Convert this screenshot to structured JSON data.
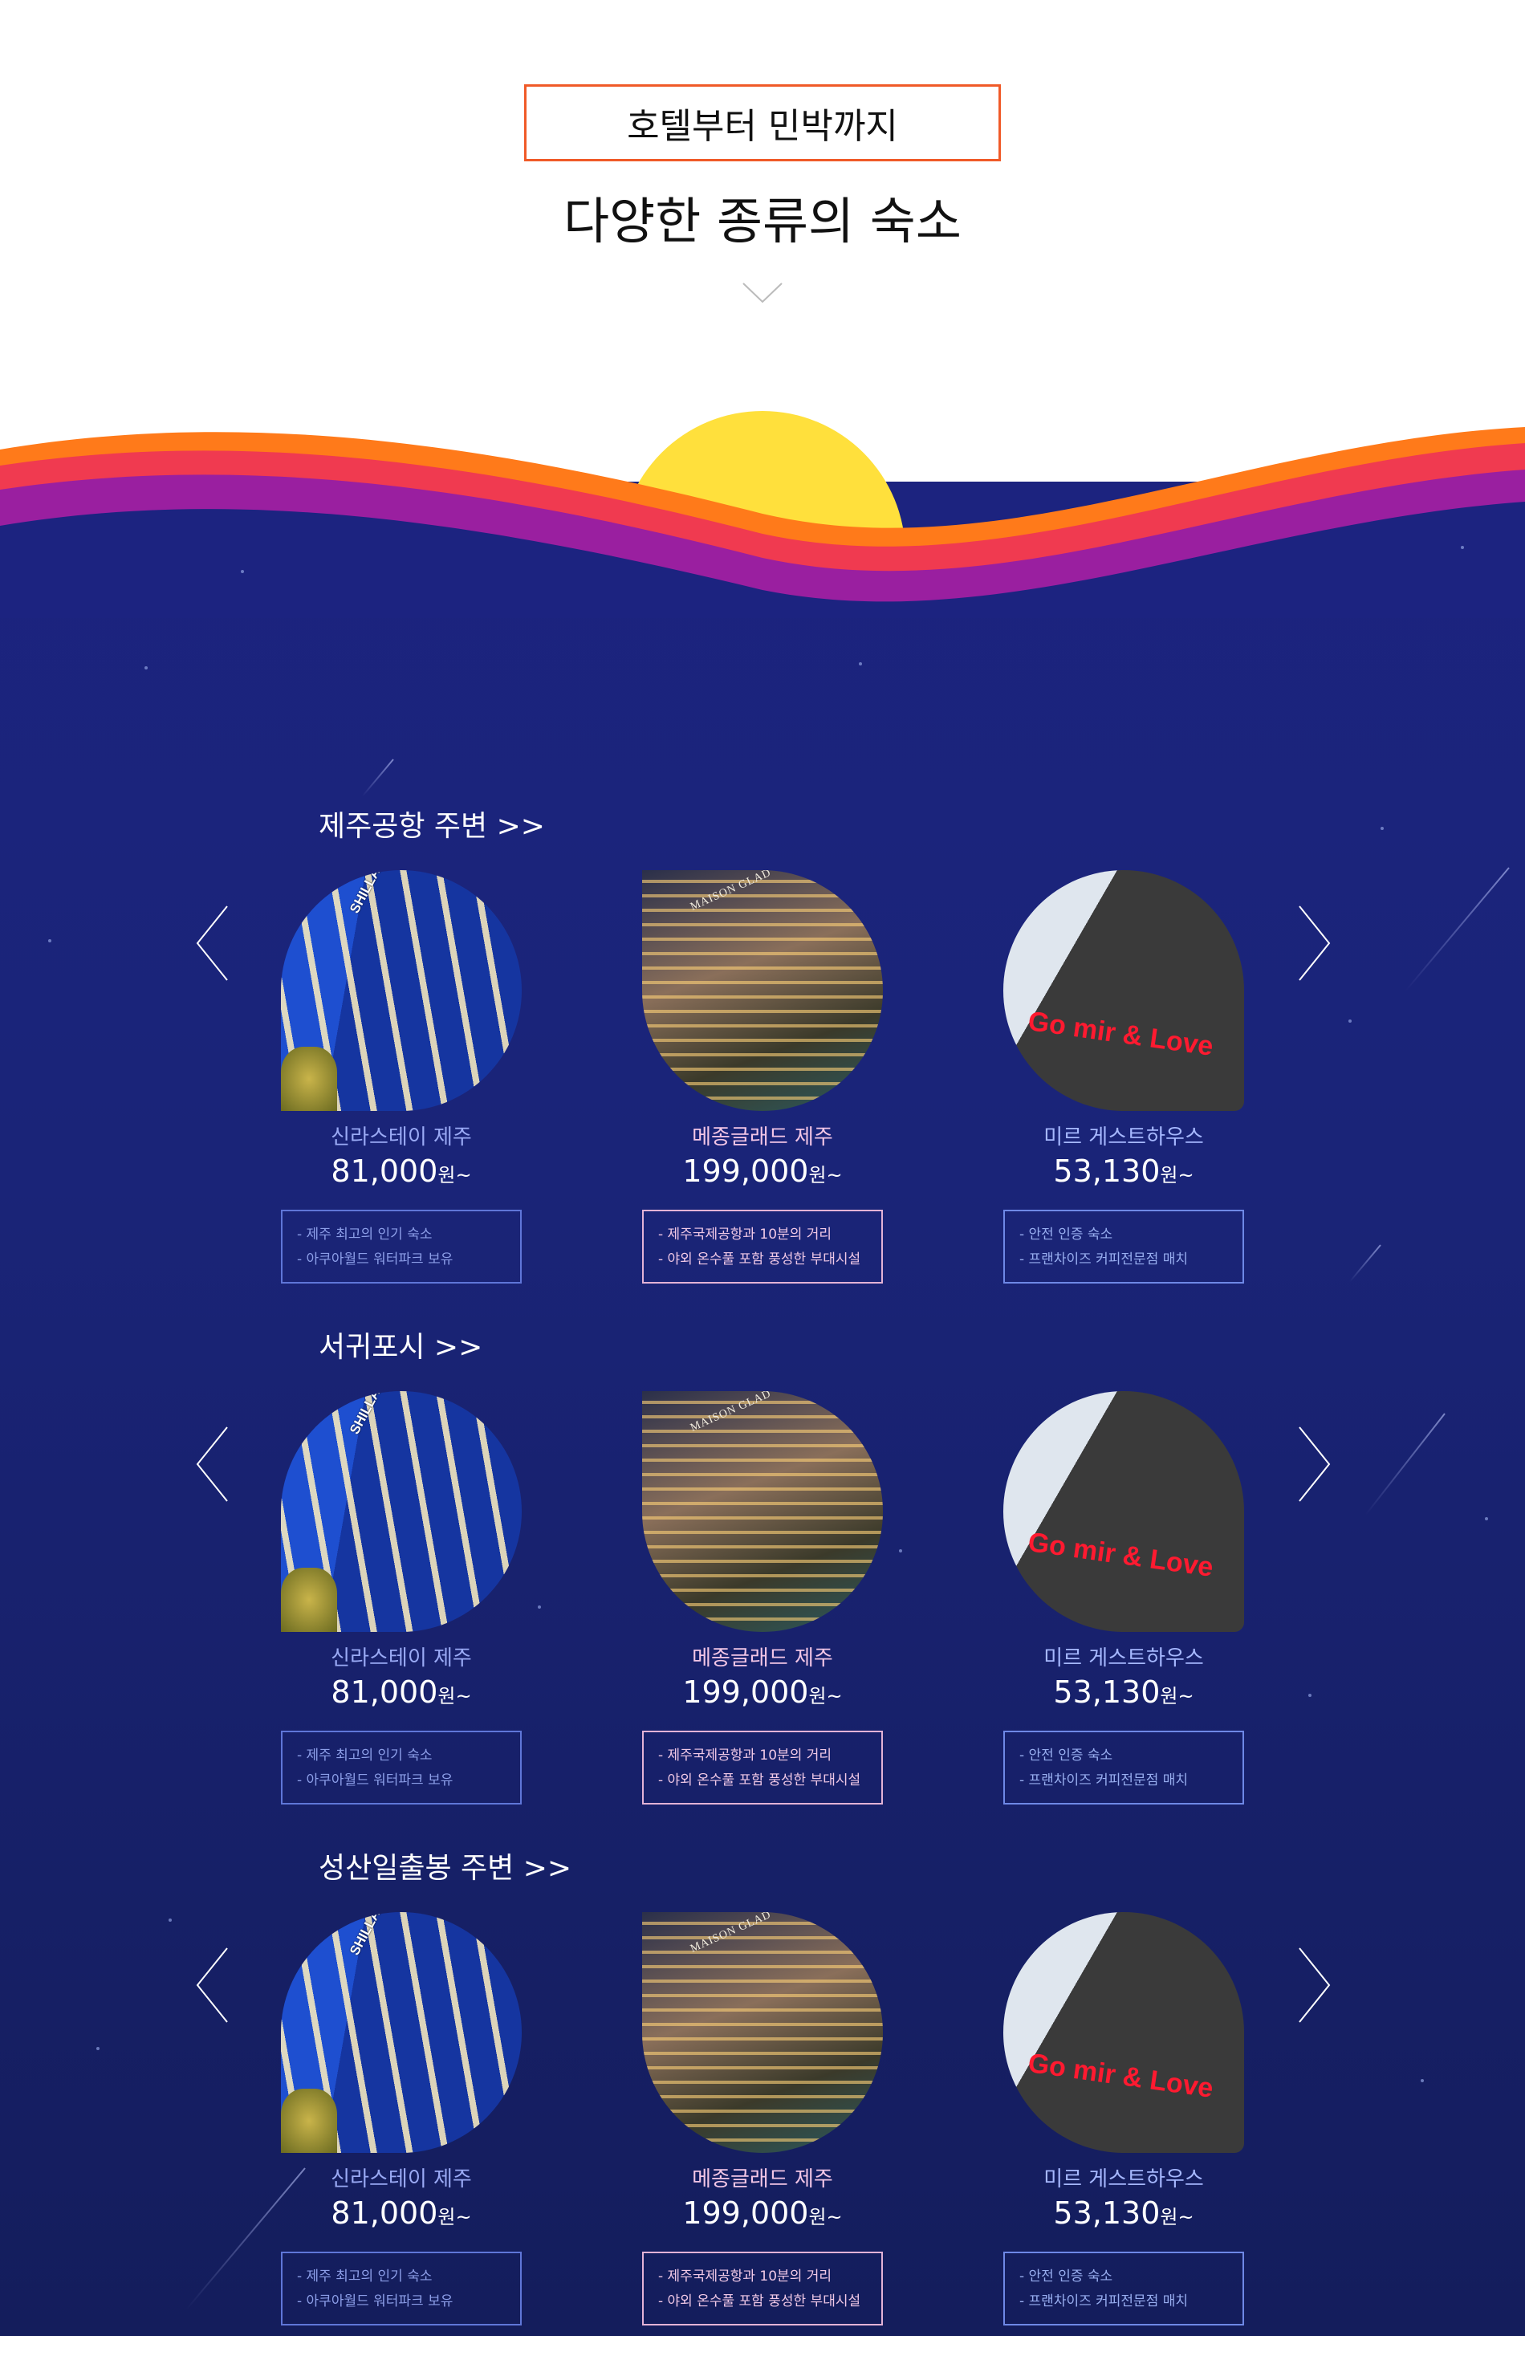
{
  "header": {
    "tag": "호텔부터 민박까지",
    "title": "다양한 종류의 숙소"
  },
  "colors": {
    "accent": "#f05a28",
    "sky": "#1a2478",
    "sun": "#ffe03c",
    "wave_orange": "#ff7a1a",
    "wave_red": "#f03a50",
    "wave_purple": "#9a1fa0"
  },
  "sections": [
    {
      "title": "제주공항 주변 >>"
    },
    {
      "title": "서귀포시 >>"
    },
    {
      "title": "성산일출봉 주변 >>"
    }
  ],
  "cards": [
    {
      "name": "신라스테이 제주",
      "price": "81,000",
      "unit": "원~",
      "image_label": "SHILLA STAY",
      "features": [
        "- 제주 최고의 인기 숙소",
        "- 아쿠아월드 워터파크 보유"
      ]
    },
    {
      "name": "메종글래드 제주",
      "price": "199,000",
      "unit": "원~",
      "image_label": "MAISON GLAD",
      "features": [
        "- 제주국제공항과 10분의 거리",
        "- 야외 온수풀 포함 풍성한 부대시설"
      ]
    },
    {
      "name": "미르 게스트하우스",
      "price": "53,130",
      "unit": "원~",
      "image_label": "Go mir & Love",
      "features": [
        "- 안전 인증 숙소",
        "- 프랜차이즈 커피전문점 매치"
      ]
    }
  ]
}
